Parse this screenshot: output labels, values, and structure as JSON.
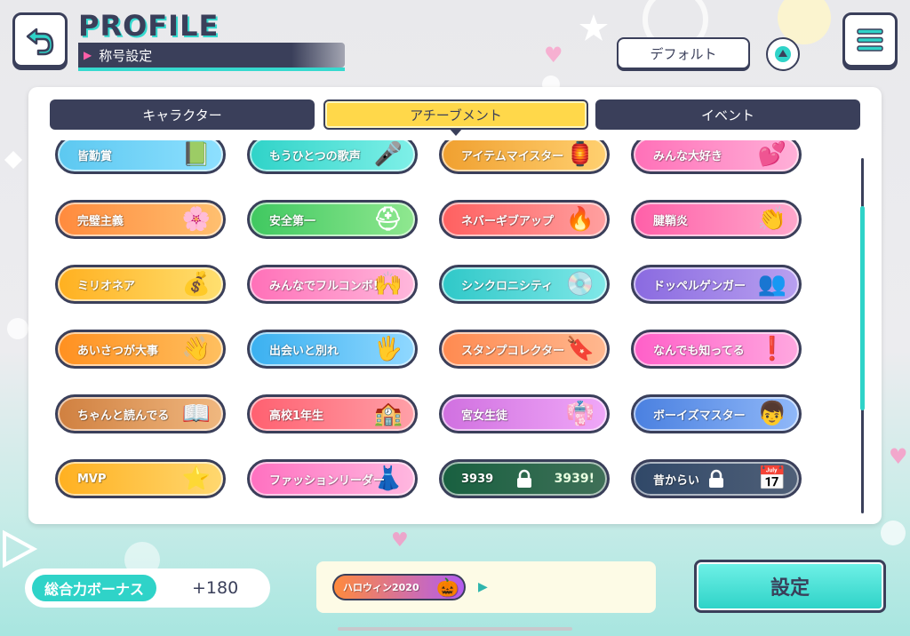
{
  "header": {
    "title": "PROFILE",
    "subtitle": "称号設定",
    "sort_label": "デフォルト"
  },
  "tabs": [
    {
      "label": "キャラクター",
      "active": false
    },
    {
      "label": "アチーブメント",
      "active": true
    },
    {
      "label": "イベント",
      "active": false
    }
  ],
  "badges": [
    {
      "label": "皆勤賞",
      "colors": [
        "#5cc8f0",
        "#8ee0ff"
      ],
      "icon": "📗",
      "locked": false
    },
    {
      "label": "もうひとつの歌声",
      "colors": [
        "#2fd3c8",
        "#7ff0e8"
      ],
      "icon": "🎤",
      "locked": false
    },
    {
      "label": "アイテムマイスター",
      "colors": [
        "#f0a030",
        "#ffd070"
      ],
      "icon": "🏮",
      "locked": false
    },
    {
      "label": "みんな大好き",
      "colors": [
        "#ff70b8",
        "#ffb0d8"
      ],
      "icon": "💕",
      "locked": false
    },
    {
      "label": "完璧主義",
      "colors": [
        "#ff8a3d",
        "#ffc070"
      ],
      "icon": "🌸",
      "locked": false
    },
    {
      "label": "安全第一",
      "colors": [
        "#3fc860",
        "#90e890"
      ],
      "icon": "⛑",
      "locked": false
    },
    {
      "label": "ネバーギブアップ",
      "colors": [
        "#ff6060",
        "#ffa0a0"
      ],
      "icon": "🔥",
      "locked": false
    },
    {
      "label": "腱鞘炎",
      "colors": [
        "#ff5fa8",
        "#ffa8cc"
      ],
      "icon": "👏",
      "locked": false
    },
    {
      "label": "ミリオネア",
      "colors": [
        "#ffb020",
        "#ffe070"
      ],
      "icon": "💰",
      "locked": false
    },
    {
      "label": "みんなでフルコンボ!",
      "colors": [
        "#ff70b8",
        "#ffb8dc"
      ],
      "icon": "🙌",
      "locked": false
    },
    {
      "label": "シンクロニシティ",
      "colors": [
        "#2fc8c8",
        "#80e8e8"
      ],
      "icon": "💿",
      "locked": false
    },
    {
      "label": "ドッペルゲンガー",
      "colors": [
        "#8a6ae0",
        "#b8a0f0"
      ],
      "icon": "👥",
      "locked": false
    },
    {
      "label": "あいさつが大事",
      "colors": [
        "#ff9020",
        "#ffc060"
      ],
      "icon": "👋",
      "locked": false
    },
    {
      "label": "出会いと別れ",
      "colors": [
        "#3ab0f0",
        "#90d8ff"
      ],
      "icon": "🖐",
      "locked": false
    },
    {
      "label": "スタンプコレクター",
      "colors": [
        "#ff8a50",
        "#ffb890"
      ],
      "icon": "🔖",
      "locked": false
    },
    {
      "label": "なんでも知ってる",
      "colors": [
        "#ff5fc8",
        "#ffa8e0"
      ],
      "icon": "❗",
      "locked": false
    },
    {
      "label": "ちゃんと読んでる",
      "colors": [
        "#d08040",
        "#f0b880"
      ],
      "icon": "📖",
      "locked": false
    },
    {
      "label": "高校1年生",
      "colors": [
        "#ff6070",
        "#ffa0a8"
      ],
      "icon": "🏫",
      "locked": false
    },
    {
      "label": "宮女生徒",
      "colors": [
        "#d070e0",
        "#f0a8f8"
      ],
      "icon": "👘",
      "locked": false
    },
    {
      "label": "ボーイズマスター",
      "colors": [
        "#4a80e0",
        "#90b8f8"
      ],
      "icon": "👦",
      "locked": false
    },
    {
      "label": "MVP",
      "colors": [
        "#ffb020",
        "#ffd870"
      ],
      "icon": "⭐",
      "locked": false
    },
    {
      "label": "ファッションリーダー",
      "colors": [
        "#ff70c0",
        "#ffb8e0"
      ],
      "icon": "👗",
      "locked": false
    },
    {
      "label": "3939",
      "colors": [
        "#30c080",
        "#80e0b0"
      ],
      "icon": "3939!",
      "locked": true
    },
    {
      "label": "昔からい",
      "colors": [
        "#6090d0",
        "#a0c0f0"
      ],
      "icon": "📅",
      "locked": true
    }
  ],
  "footer": {
    "bonus_label": "総合力ボーナス",
    "bonus_value": "+180",
    "equipped_badge": "ハロウィン2020",
    "set_label": "設定"
  }
}
